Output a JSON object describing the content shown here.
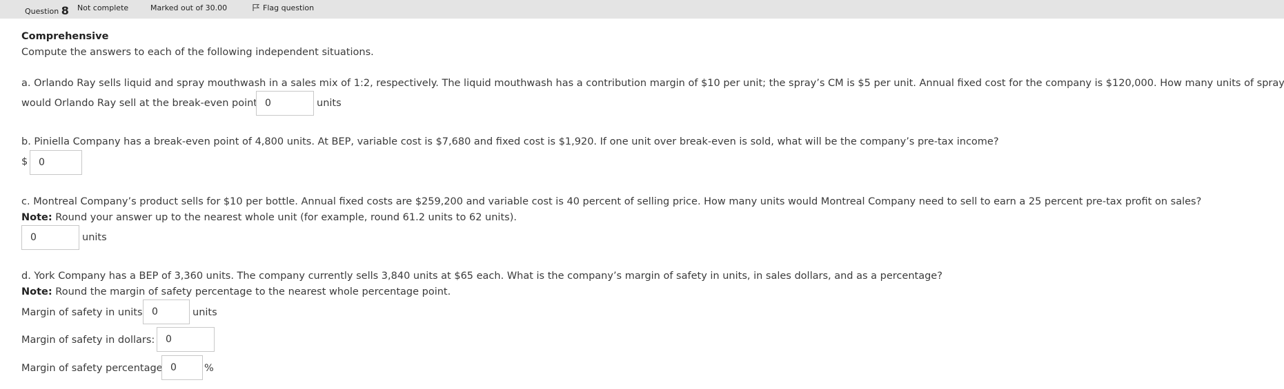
{
  "info_bar": {
    "question_label": "Question",
    "question_number": "8",
    "status": "Not complete",
    "marks": "Marked out of 30.00",
    "flag_label": "Flag question"
  },
  "title": "Comprehensive",
  "intro": "Compute the answers to each of the following independent situations.",
  "part_a": {
    "text_line1": "a. Orlando Ray sells liquid and spray mouthwash in a sales mix of 1:2, respectively. The liquid mouthwash has a contribution margin of $10 per unit; the spray’s CM is $5 per unit. Annual fixed cost for the company is $120,000. How many units of spray mouthwash",
    "text_line2": "would Orlando Ray sell at the break-even point?",
    "value": "0",
    "unit": "units"
  },
  "part_b": {
    "text": "b. Piniella Company has a break-even point of 4,800 units. At BEP, variable cost is $7,680 and fixed cost is $1,920. If one unit over break-even is sold, what will be the company’s pre-tax income?",
    "currency": "$",
    "value": "0"
  },
  "part_c": {
    "text": "c. Montreal Company’s product sells for $10 per bottle. Annual fixed costs are $259,200 and variable cost is 40 percent of selling price. How many units would Montreal Company need to sell to earn a 25 percent pre-tax profit on sales?",
    "note_label": "Note:",
    "note": "Round your answer up to the nearest whole unit (for example, round 61.2 units to 62 units).",
    "value": "0",
    "unit": "units"
  },
  "part_d": {
    "text": "d. York Company has a BEP of 3,360 units. The company currently sells 3,840 units at $65 each. What is the company’s margin of safety in units, in sales dollars, and as a percentage?",
    "note_label": "Note:",
    "note": "Round the margin of safety percentage to the nearest whole percentage point.",
    "units_label": "Margin of safety in units:",
    "units_value": "0",
    "units_unit": "units",
    "dollars_label": "Margin of safety in dollars: $",
    "dollars_value": "0",
    "percent_label": "Margin of safety percentage:",
    "percent_value": "0",
    "percent_unit": "%"
  }
}
